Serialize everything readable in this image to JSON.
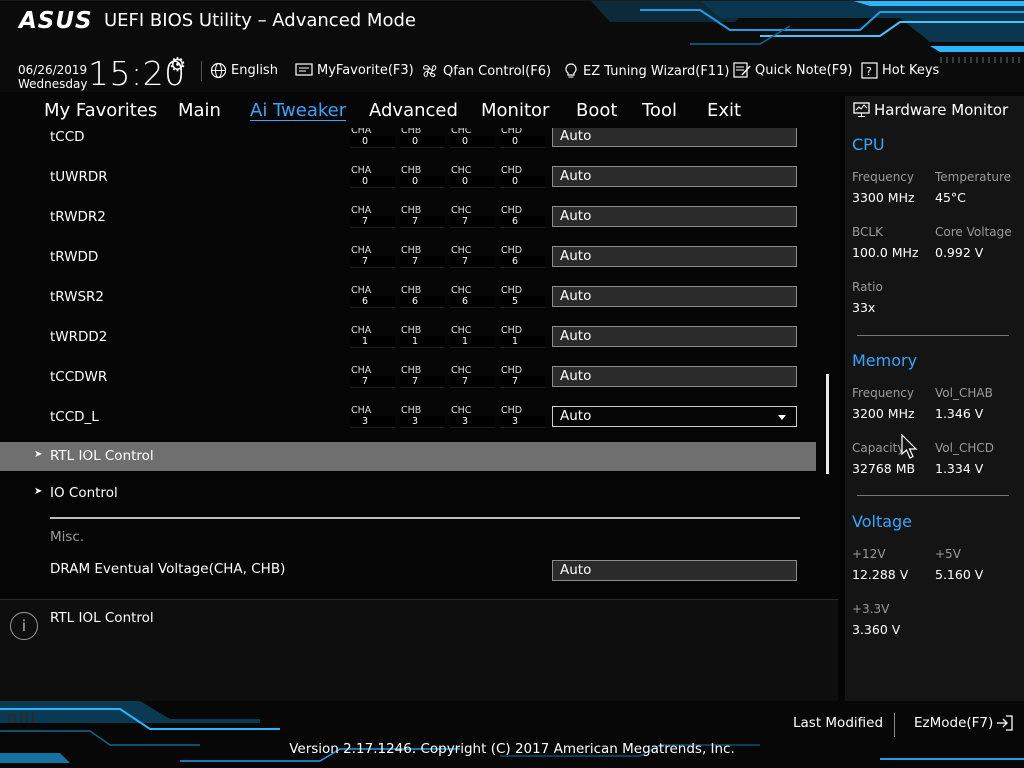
{
  "header": {
    "logo": "ASUS",
    "title": "UEFI BIOS Utility – Advanced Mode",
    "date": "06/26/2019",
    "weekday": "Wednesday",
    "time": "15:20",
    "toolbar": {
      "language": "English",
      "myfavorite": "MyFavorite(F3)",
      "qfan": "Qfan Control(F6)",
      "ez_tuning": "EZ Tuning Wizard(F11)",
      "quick_note": "Quick Note(F9)",
      "hot_keys": "Hot Keys"
    }
  },
  "tabs": [
    "My Favorites",
    "Main",
    "Ai Tweaker",
    "Advanced",
    "Monitor",
    "Boot",
    "Tool",
    "Exit"
  ],
  "active_tab": "Ai Tweaker",
  "channels": [
    "CHA",
    "CHB",
    "CHC",
    "CHD"
  ],
  "rows": [
    {
      "label": "tCCD",
      "values": [
        "0",
        "0",
        "0",
        "0"
      ],
      "setting": "Auto"
    },
    {
      "label": "tUWRDR",
      "values": [
        "0",
        "0",
        "0",
        "0"
      ],
      "setting": "Auto"
    },
    {
      "label": "tRWDR2",
      "values": [
        "7",
        "7",
        "7",
        "6"
      ],
      "setting": "Auto"
    },
    {
      "label": "tRWDD",
      "values": [
        "7",
        "7",
        "7",
        "6"
      ],
      "setting": "Auto"
    },
    {
      "label": "tRWSR2",
      "values": [
        "6",
        "6",
        "6",
        "5"
      ],
      "setting": "Auto"
    },
    {
      "label": "tWRDD2",
      "values": [
        "1",
        "1",
        "1",
        "1"
      ],
      "setting": "Auto"
    },
    {
      "label": "tCCDWR",
      "values": [
        "7",
        "7",
        "7",
        "7"
      ],
      "setting": "Auto"
    },
    {
      "label": "tCCD_L",
      "values": [
        "3",
        "3",
        "3",
        "3"
      ],
      "setting": "Auto"
    }
  ],
  "submenus": [
    "RTL IOL Control",
    "IO Control"
  ],
  "misc_label": "Misc.",
  "dram_voltage": {
    "label": "DRAM Eventual Voltage(CHA, CHB)",
    "setting": "Auto"
  },
  "help_text": "RTL IOL Control",
  "hw_monitor": {
    "title": "Hardware Monitor",
    "cpu": {
      "heading": "CPU",
      "frequency_label": "Frequency",
      "frequency": "3300 MHz",
      "temperature_label": "Temperature",
      "temperature": "45°C",
      "bclk_label": "BCLK",
      "bclk": "100.0 MHz",
      "core_voltage_label": "Core Voltage",
      "core_voltage": "0.992 V",
      "ratio_label": "Ratio",
      "ratio": "33x"
    },
    "memory": {
      "heading": "Memory",
      "frequency_label": "Frequency",
      "frequency": "3200 MHz",
      "vol_chab_label": "Vol_CHAB",
      "vol_chab": "1.346 V",
      "capacity_label": "Capacity",
      "capacity": "32768 MB",
      "vol_chcd_label": "Vol_CHCD",
      "vol_chcd": "1.334 V"
    },
    "voltage": {
      "heading": "Voltage",
      "v12_label": "+12V",
      "v12": "12.288 V",
      "v5_label": "+5V",
      "v5": "5.160 V",
      "v33_label": "+3.3V",
      "v33": "3.360 V"
    }
  },
  "footer": {
    "last_modified": "Last Modified",
    "ezmode": "EzMode(F7)",
    "version": "Version 2.17.1246. Copyright (C) 2017 American Megatrends, Inc."
  },
  "colors": {
    "accent": "#33a6ff",
    "highlight_row": "#6f6f6f",
    "panel": "#141414"
  }
}
